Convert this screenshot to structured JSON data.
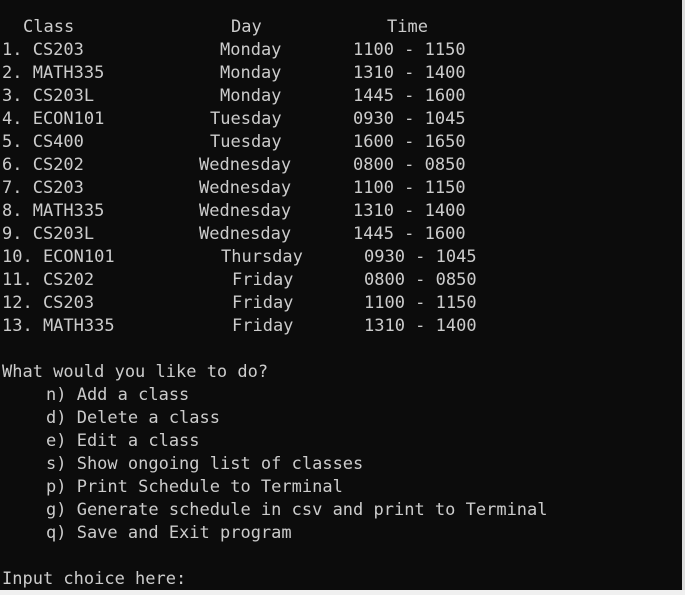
{
  "header": {
    "class": "Class",
    "day": "Day",
    "time": "Time"
  },
  "rows": [
    {
      "class": "1. CS203",
      "day": "Monday",
      "time": "1100 - 1150"
    },
    {
      "class": "2. MATH335",
      "day": "Monday",
      "time": "1310 - 1400"
    },
    {
      "class": "3. CS203L",
      "day": "Monday",
      "time": "1445 - 1600"
    },
    {
      "class": "4. ECON101",
      "day": "Tuesday",
      "time": "0930 - 1045"
    },
    {
      "class": "5. CS400",
      "day": "Tuesday",
      "time": "1600 - 1650"
    },
    {
      "class": "6. CS202",
      "day": "Wednesday",
      "time": "0800 - 0850"
    },
    {
      "class": "7. CS203",
      "day": "Wednesday",
      "time": "1100 - 1150"
    },
    {
      "class": "8. MATH335",
      "day": "Wednesday",
      "time": "1310 - 1400"
    },
    {
      "class": "9. CS203L",
      "day": "Wednesday",
      "time": "1445 - 1600"
    },
    {
      "class": "10. ECON101",
      "day": "Thursday",
      "time": "0930 - 1045"
    },
    {
      "class": "11. CS202",
      "day": "Friday",
      "time": "0800 - 0850"
    },
    {
      "class": "12. CS203",
      "day": "Friday",
      "time": "1100 - 1150"
    },
    {
      "class": "13. MATH335",
      "day": "Friday",
      "time": "1310 - 1400"
    }
  ],
  "menu": {
    "prompt": "What would you like to do?",
    "options": [
      "n) Add a class",
      "d) Delete a class",
      "e) Edit a class",
      "s) Show ongoing list of classes",
      "p) Print Schedule to Terminal",
      "g) Generate schedule in csv and print to Terminal",
      "q) Save and Exit program"
    ]
  },
  "input_prompt": "Input choice here:",
  "colors": {
    "background": "#0c0c0c",
    "text": "#cccccc"
  }
}
